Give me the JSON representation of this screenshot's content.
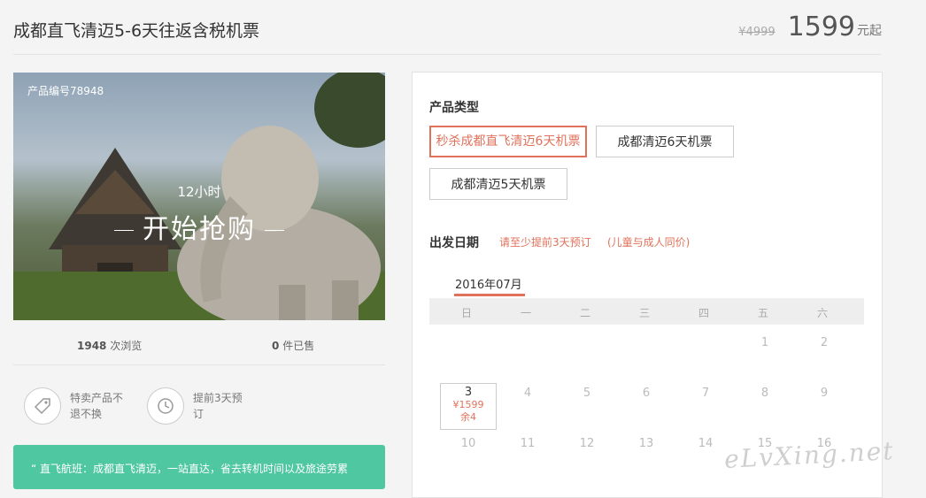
{
  "header": {
    "title": "成都直飞清迈5-6天往返含税机票",
    "old_price": "¥4999",
    "price": "1599",
    "price_unit": "元起"
  },
  "hero": {
    "product_no": "产品编号78948",
    "countdown_top": "12小时",
    "countdown_main": "开始抢购"
  },
  "stats": {
    "views_num": "1948",
    "views_label": "次浏览",
    "sold_num": "0",
    "sold_label": "件已售"
  },
  "features": [
    {
      "icon": "tag-icon",
      "text": "特卖产品不退不换"
    },
    {
      "icon": "clock-icon",
      "text": "提前3天预订"
    }
  ],
  "note": "“ 直飞航班：成都直飞清迈，一站直达，省去转机时间以及旅途劳累",
  "panel": {
    "product_type_label": "产品类型",
    "options": [
      "秒杀成都直飞清迈6天机票",
      "成都清迈6天机票",
      "成都清迈5天机票"
    ],
    "date_label": "出发日期",
    "hint1": "请至少提前3天预订",
    "hint2": "(儿童与成人同价)",
    "month": "2016年07月",
    "weekdays": [
      "日",
      "一",
      "二",
      "三",
      "四",
      "五",
      "六"
    ],
    "days_row1": [
      "1",
      "2"
    ],
    "days_row2": [
      "4",
      "5",
      "6",
      "7",
      "8",
      "9"
    ],
    "days_row3": [
      "10",
      "11",
      "12",
      "13",
      "14",
      "15",
      "16"
    ],
    "selected_day": {
      "num": "3",
      "price": "¥1599",
      "left": "余4"
    }
  },
  "watermark": "eLvXing.net",
  "colors": {
    "accent": "#e0725b",
    "note_bg": "#4fc7a0"
  }
}
